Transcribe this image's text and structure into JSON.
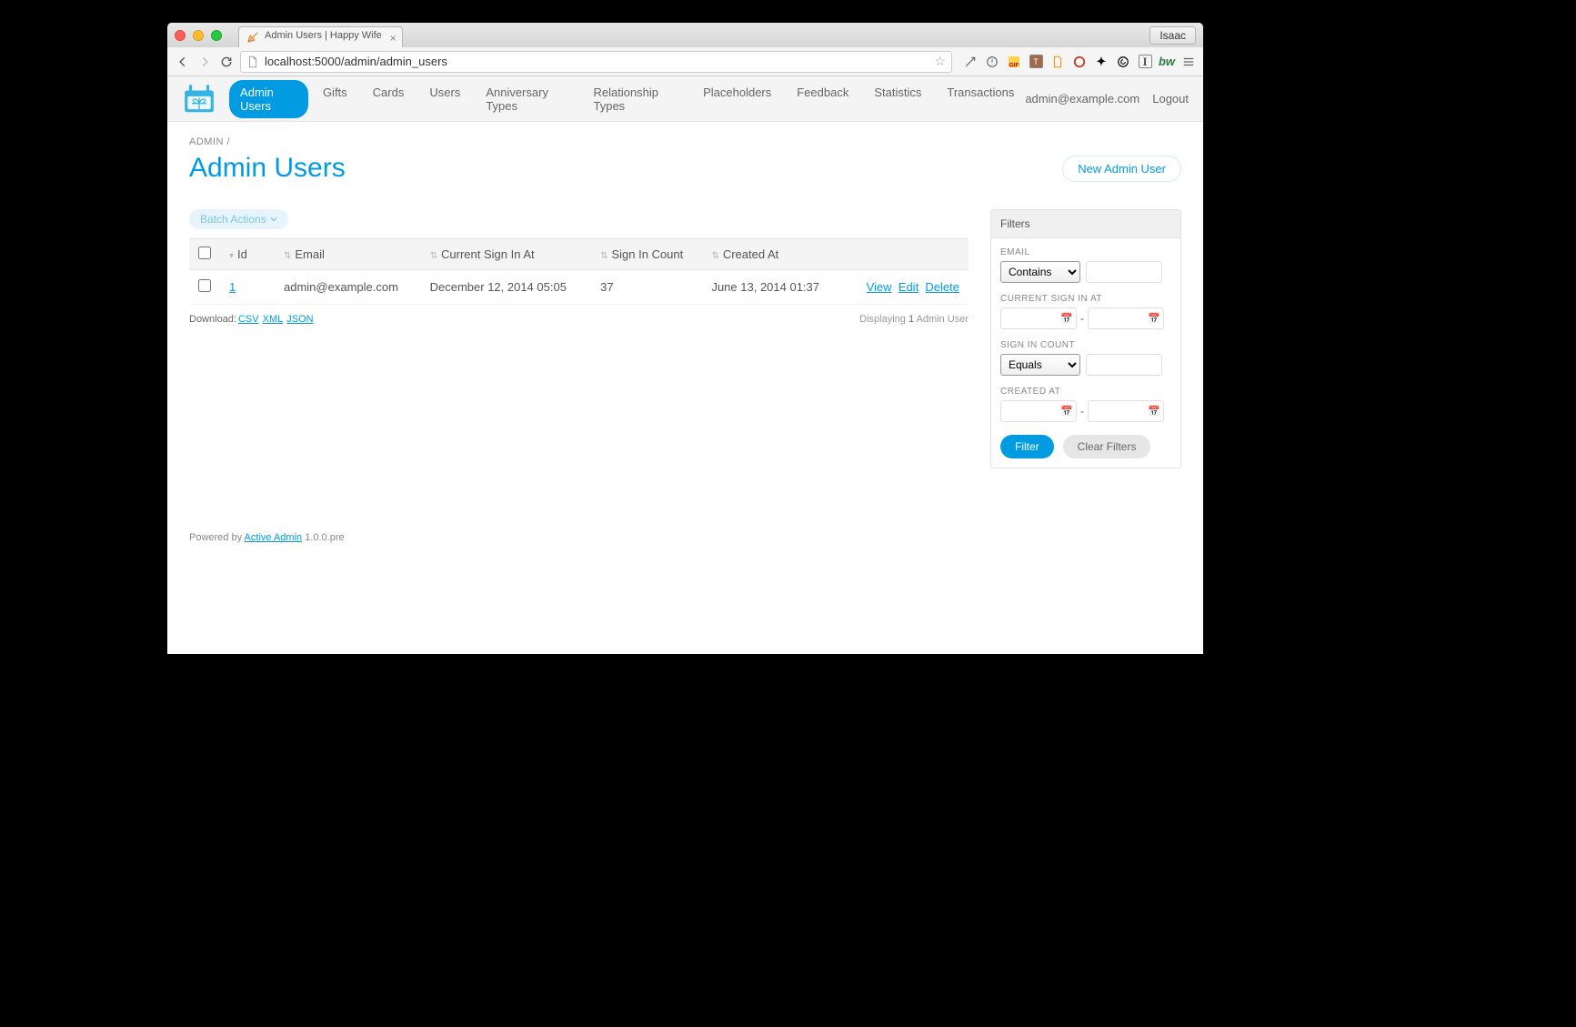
{
  "chrome": {
    "tab_title": "Admin Users | Happy Wife",
    "user_badge": "Isaac",
    "url_host": "localhost",
    "url_port_path": ":5000/admin/admin_users"
  },
  "header": {
    "nav": [
      {
        "label": "Admin Users",
        "active": true
      },
      {
        "label": "Gifts"
      },
      {
        "label": "Cards"
      },
      {
        "label": "Users"
      },
      {
        "label": "Anniversary Types"
      },
      {
        "label": "Relationship Types"
      },
      {
        "label": "Placeholders"
      },
      {
        "label": "Feedback"
      },
      {
        "label": "Statistics"
      },
      {
        "label": "Transactions"
      }
    ],
    "current_user": "admin@example.com",
    "logout": "Logout"
  },
  "breadcrumb": {
    "root": "ADMIN",
    "sep": "/"
  },
  "title": "Admin Users",
  "new_button": "New Admin User",
  "batch_actions": "Batch Actions",
  "table": {
    "columns": [
      "Id",
      "Email",
      "Current Sign In At",
      "Sign In Count",
      "Created At"
    ],
    "rows": [
      {
        "id": "1",
        "email": "admin@example.com",
        "current_sign_in_at": "December 12, 2014 05:05",
        "sign_in_count": "37",
        "created_at": "June 13, 2014 01:37",
        "actions": {
          "view": "View",
          "edit": "Edit",
          "delete": "Delete"
        }
      }
    ]
  },
  "download": {
    "label": "Download:",
    "csv": "CSV",
    "xml": "XML",
    "json": "JSON"
  },
  "pagination": {
    "prefix": "Displaying",
    "count": "1",
    "suffix": "Admin User"
  },
  "filters": {
    "title": "Filters",
    "email": {
      "label": "EMAIL",
      "operator": "Contains"
    },
    "current_sign_in_at": {
      "label": "CURRENT SIGN IN AT",
      "sep": "-"
    },
    "sign_in_count": {
      "label": "SIGN IN COUNT",
      "operator": "Equals"
    },
    "created_at": {
      "label": "CREATED AT",
      "sep": "-"
    },
    "filter_btn": "Filter",
    "clear_btn": "Clear Filters"
  },
  "footer": {
    "prefix": "Powered by ",
    "link": "Active Admin",
    "suffix": " 1.0.0.pre"
  }
}
